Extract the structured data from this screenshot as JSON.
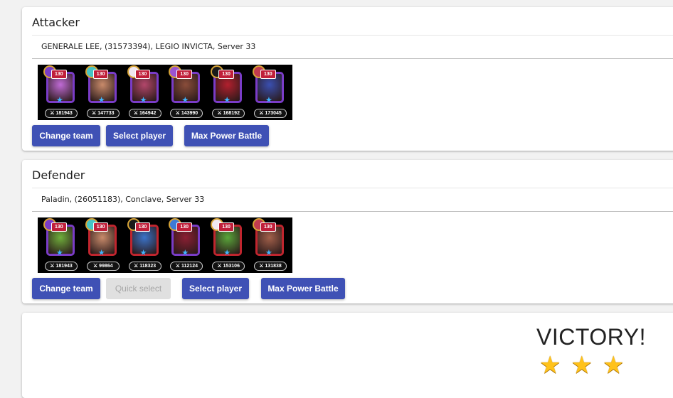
{
  "attacker": {
    "title": "Attacker",
    "player": "GENERALE LEE, (31573394), LEGIO INVICTA, Server 33",
    "team": [
      {
        "level": "130",
        "power": "181943",
        "frame_color": "#7a3cc7",
        "portrait_color": "#c06bd6",
        "pet_color": "#7a3cc7"
      },
      {
        "level": "130",
        "power": "147733",
        "frame_color": "#7a3cc7",
        "portrait_color": "#c98b6b",
        "pet_color": "#45c4c4"
      },
      {
        "level": "130",
        "power": "164942",
        "frame_color": "#7a3cc7",
        "portrait_color": "#b3476b",
        "pet_color": "#f0e7f0"
      },
      {
        "level": "130",
        "power": "143990",
        "frame_color": "#7a3cc7",
        "portrait_color": "#8a4d3a",
        "pet_color": "#9b54d1"
      },
      {
        "level": "130",
        "power": "168192",
        "frame_color": "#7a3cc7",
        "portrait_color": "#b2202e",
        "pet_color": "#1a1a1a"
      },
      {
        "level": "130",
        "power": "173045",
        "frame_color": "#7a3cc7",
        "portrait_color": "#3a4fb0",
        "pet_color": "#c23b4f"
      }
    ],
    "buttons": {
      "change_team": "Change team",
      "select_player": "Select player",
      "max_power": "Max Power Battle"
    }
  },
  "defender": {
    "title": "Defender",
    "player": "Paladin, (26051183), Conclave, Server 33",
    "team": [
      {
        "level": "130",
        "power": "181943",
        "frame_color": "#7a3cc7",
        "portrait_color": "#6fae3b",
        "pet_color": "#7a3cc7"
      },
      {
        "level": "130",
        "power": "99864",
        "frame_color": "#c0252e",
        "portrait_color": "#c98b6b",
        "pet_color": "#45c4c4"
      },
      {
        "level": "130",
        "power": "118323",
        "frame_color": "#c0252e",
        "portrait_color": "#3b73c9",
        "pet_color": "#1a1a1a"
      },
      {
        "level": "130",
        "power": "112124",
        "frame_color": "#7a3cc7",
        "portrait_color": "#8b1f33",
        "pet_color": "#3c7ad6"
      },
      {
        "level": "130",
        "power": "153106",
        "frame_color": "#c0252e",
        "portrait_color": "#5aa63a",
        "pet_color": "#f0e7f0"
      },
      {
        "level": "130",
        "power": "131838",
        "frame_color": "#c0252e",
        "portrait_color": "#a2604a",
        "pet_color": "#c23b4f"
      }
    ],
    "buttons": {
      "change_team": "Change team",
      "quick_select": "Quick select",
      "select_player": "Select player",
      "max_power": "Max Power Battle"
    }
  },
  "result": {
    "text": "VICTORY!",
    "stars": 3,
    "star_color": "#ffc21a"
  },
  "colors": {
    "primary": "#3f51b5",
    "disabled": "#e0e0e0"
  }
}
